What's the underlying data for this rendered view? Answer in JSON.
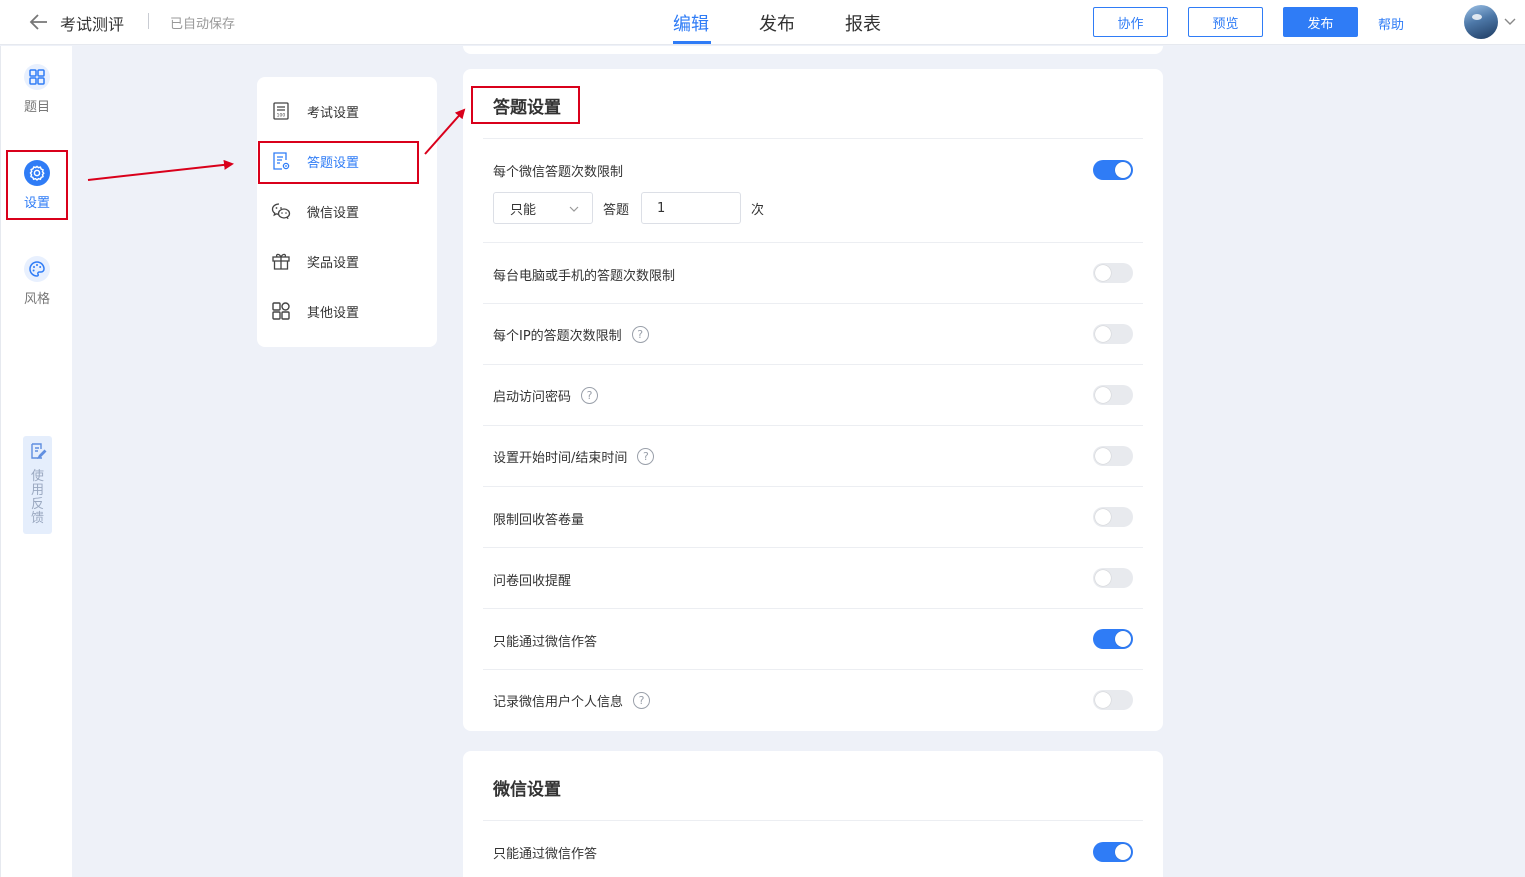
{
  "header": {
    "title": "考试测评",
    "autosave": "已自动保存",
    "tabs": [
      {
        "label": "编辑",
        "active": true
      },
      {
        "label": "发布",
        "active": false
      },
      {
        "label": "报表",
        "active": false
      }
    ],
    "buttons": {
      "collab": "协作",
      "preview": "预览",
      "publish": "发布"
    },
    "help": "帮助"
  },
  "rail": {
    "items": [
      {
        "label": "题目",
        "icon": "grid-icon"
      },
      {
        "label": "设置",
        "icon": "gear-icon",
        "active": true
      },
      {
        "label": "风格",
        "icon": "palette-icon"
      }
    ],
    "feedback": "使用反馈"
  },
  "submenu": {
    "items": [
      {
        "label": "考试设置",
        "icon": "exam-icon"
      },
      {
        "label": "答题设置",
        "icon": "answer-settings-icon",
        "active": true
      },
      {
        "label": "微信设置",
        "icon": "wechat-icon"
      },
      {
        "label": "奖品设置",
        "icon": "gift-icon"
      },
      {
        "label": "其他设置",
        "icon": "apps-icon"
      }
    ]
  },
  "answer_settings": {
    "title": "答题设置",
    "wechat_limit": {
      "label": "每个微信答题次数限制",
      "enabled": true,
      "mode": "只能",
      "mid_text": "答题",
      "count": "1",
      "unit": "次"
    },
    "rows": [
      {
        "label": "每台电脑或手机的答题次数限制",
        "help": false,
        "enabled": false
      },
      {
        "label": "每个IP的答题次数限制",
        "help": true,
        "enabled": false
      },
      {
        "label": "启动访问密码",
        "help": true,
        "enabled": false
      },
      {
        "label": "设置开始时间/结束时间",
        "help": true,
        "enabled": false
      },
      {
        "label": "限制回收答卷量",
        "help": false,
        "enabled": false
      },
      {
        "label": "问卷回收提醒",
        "help": false,
        "enabled": false
      },
      {
        "label": "只能通过微信作答",
        "help": false,
        "enabled": true
      },
      {
        "label": "记录微信用户个人信息",
        "help": true,
        "enabled": false
      }
    ]
  },
  "wechat_settings": {
    "title": "微信设置",
    "rows": [
      {
        "label": "只能通过微信作答",
        "enabled": true
      }
    ]
  },
  "help_glyph": "?",
  "colors": {
    "accent": "#2f7cf6",
    "annotation": "#d9001b"
  }
}
